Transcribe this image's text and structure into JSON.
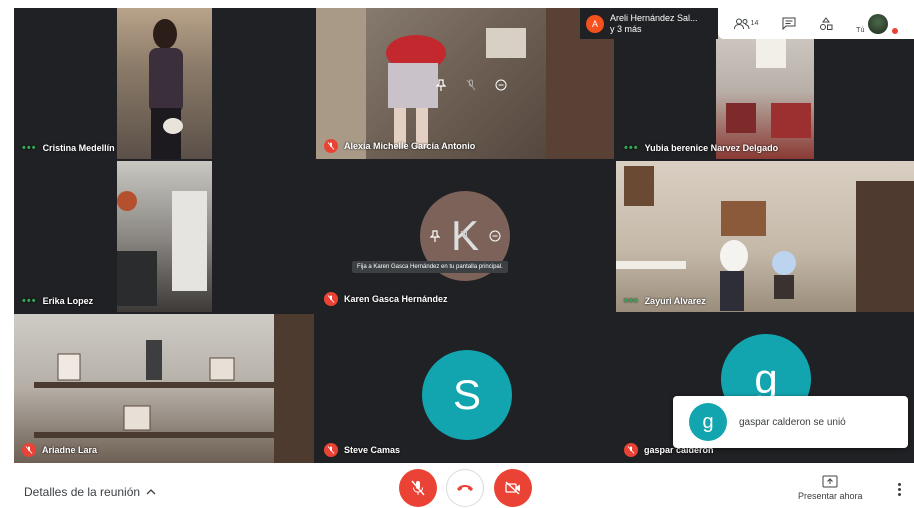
{
  "participants": [
    {
      "name": "Cristina Medellín",
      "muted": false
    },
    {
      "name": "Alexia Michelle García Antonio",
      "muted": true
    },
    {
      "name": "Yubia berenice Narvez Delgado",
      "muted": false
    },
    {
      "name": "Erika Lopez",
      "muted": false
    },
    {
      "name": "Karen Gasca Hernández",
      "muted": true,
      "initial": "K"
    },
    {
      "name": "Zayuri Alvarez",
      "muted": false
    },
    {
      "name": "Ariadne Lara",
      "muted": true
    },
    {
      "name": "Steve Camas",
      "muted": true,
      "initial": "S"
    },
    {
      "name": "gaspar calderon",
      "muted": true,
      "initial": "g"
    }
  ],
  "speaker": {
    "initial": "A",
    "line1": "Areli Hernández Sal...",
    "line2": "y 3 más"
  },
  "top_bar": {
    "people_count": "14",
    "self_label": "Tú"
  },
  "tooltip": "Fija a Karen Gasca Hernández en tu pantalla principal.",
  "toast": {
    "initial": "g",
    "message": "gaspar calderon se unió"
  },
  "bottom_bar": {
    "details_label": "Detalles de la reunión",
    "present_label": "Presentar ahora"
  },
  "colors": {
    "tile_bg": "#202124",
    "mic_off": "#ea4335",
    "avatar_teal": "#12a4af",
    "speaking_dots": "#34a853",
    "speaker_avatar": "#f4511e"
  }
}
